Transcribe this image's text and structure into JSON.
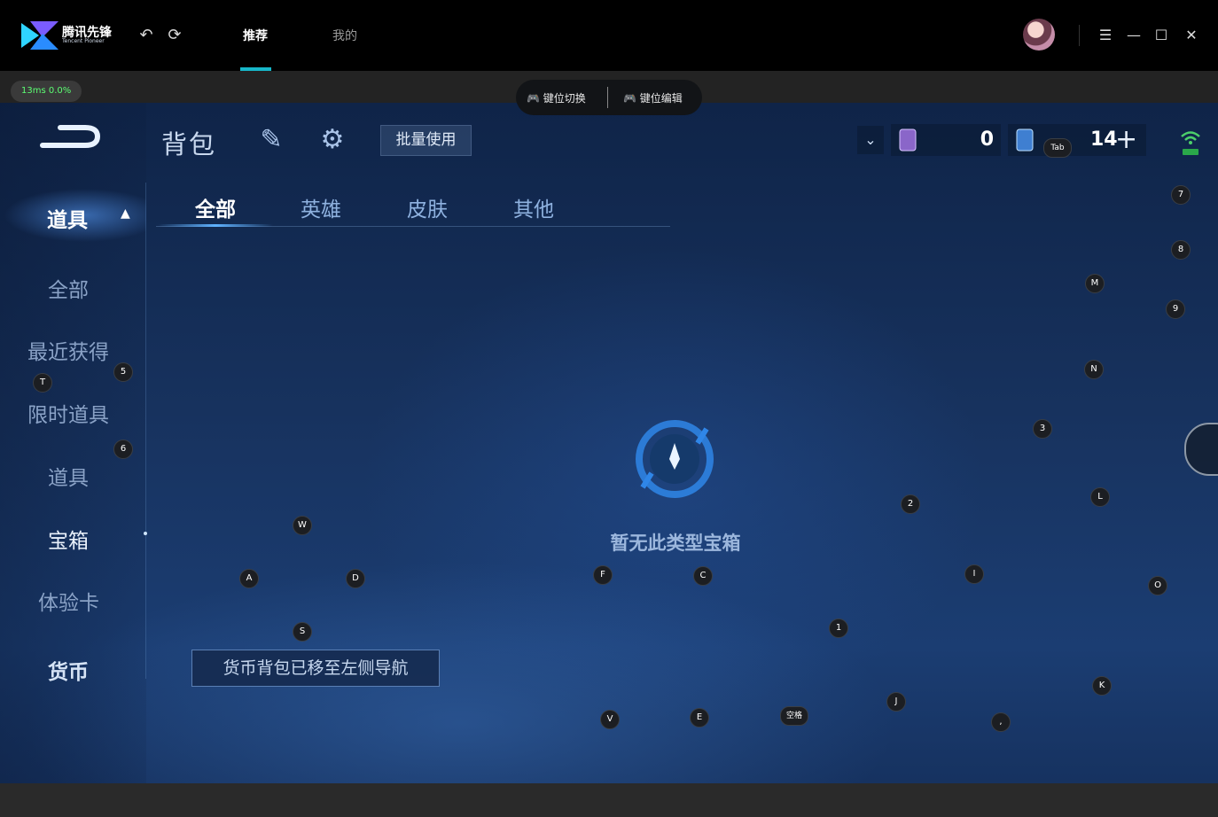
{
  "app": {
    "logo_text": "腾讯先锋",
    "logo_sub": "Tencent Pioneer",
    "tabs": [
      "推荐",
      "我的"
    ]
  },
  "overlay": {
    "perf_text": "13ms  0.0%",
    "key_switch": "键位切换",
    "key_edit": "键位编辑"
  },
  "game": {
    "title": "背包",
    "batch_use": "批量使用",
    "currency_a": "0",
    "currency_b": "14",
    "side_header": "道具",
    "side_items": [
      "全部",
      "最近获得",
      "限时道具",
      "道具",
      "宝箱",
      "体验卡",
      "货币"
    ],
    "tabs": [
      "全部",
      "英雄",
      "皮肤",
      "其他"
    ],
    "empty_text": "暂无此类型宝箱",
    "tooltip": "货币背包已移至左侧导航"
  },
  "keys": {
    "tab": "Tab",
    "k7": "7",
    "k8": "8",
    "kM": "M",
    "k9": "9",
    "kN": "N",
    "k3": "3",
    "k5": "5",
    "kT": "T",
    "k6": "6",
    "kW": "W",
    "kA": "A",
    "kD": "D",
    "kS": "S",
    "kF": "F",
    "kC": "C",
    "k2": "2",
    "kL": "L",
    "kI": "I",
    "kO": "O",
    "k1": "1",
    "kJ": "J",
    "kK": "K",
    "kV": "V",
    "kE": "E",
    "kSpace": "空格",
    "kComma": ","
  },
  "colors": {
    "accent": "#17b7c9",
    "perf_green": "#5cff73",
    "game_bg": "#17325e"
  }
}
